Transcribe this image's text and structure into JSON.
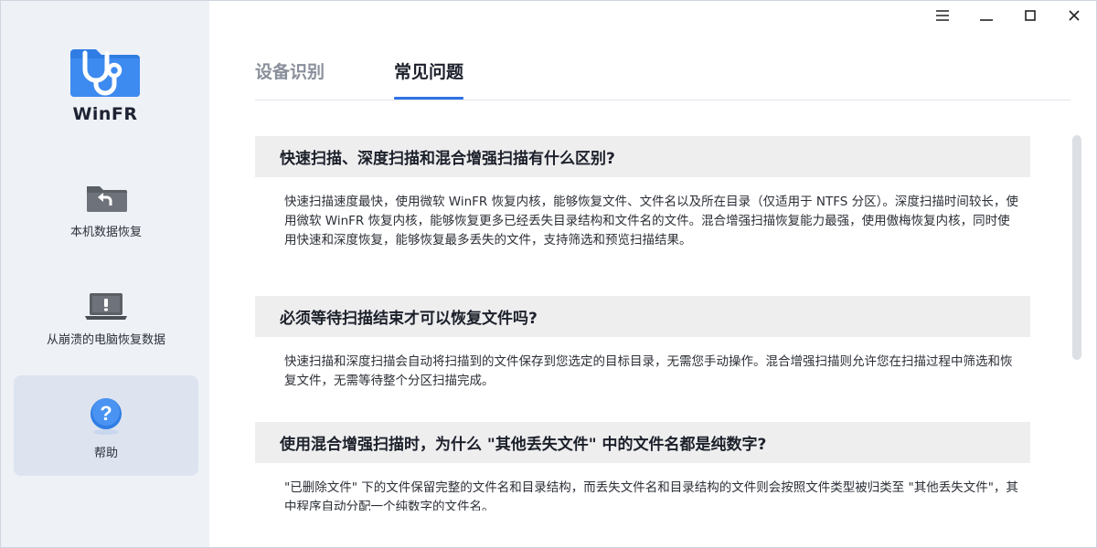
{
  "app": {
    "name": "WinFR"
  },
  "sidebar": {
    "items": [
      {
        "label": "本机数据恢复",
        "icon": "folder-restore-icon"
      },
      {
        "label": "从崩溃的电脑恢复数据",
        "icon": "laptop-warning-icon"
      },
      {
        "label": "帮助",
        "icon": "help-icon",
        "active": true
      }
    ]
  },
  "titlebar": {
    "buttons": [
      "menu-icon",
      "minimize-icon",
      "maximize-icon",
      "close-icon"
    ]
  },
  "tabs": [
    {
      "label": "设备识别",
      "active": false
    },
    {
      "label": "常见问题",
      "active": true
    }
  ],
  "faq": [
    {
      "question": "快速扫描、深度扫描和混合增强扫描有什么区别?",
      "answer": "快速扫描速度最快，使用微软 WinFR 恢复内核，能够恢复文件、文件名以及所在目录（仅适用于 NTFS 分区）。深度扫描时间较长，使用微软 WinFR 恢复内核，能够恢复更多已经丢失目录结构和文件名的文件。混合增强扫描恢复能力最强，使用傲梅恢复内核，同时使用快速和深度恢复，能够恢复最多丢失的文件，支持筛选和预览扫描结果。"
    },
    {
      "question": "必须等待扫描结束才可以恢复文件吗?",
      "answer": "快速扫描和深度扫描会自动将扫描到的文件保存到您选定的目标目录，无需您手动操作。混合增强扫描则允许您在扫描过程中筛选和恢复文件，无需等待整个分区扫描完成。"
    },
    {
      "question": "使用混合增强扫描时，为什么 \"其他丢失文件\" 中的文件名都是纯数字?",
      "answer": "\"已删除文件\" 下的文件保留完整的文件名和目录结构，而丢失文件名和目录结构的文件则会按照文件类型被归类至 \"其他丢失文件\"，其中程序自动分配一个纯数字的文件名。"
    }
  ],
  "colors": {
    "accent": "#2f72e6",
    "sidebar_bg": "#eef1f6",
    "active_item_bg": "#dde4f0",
    "question_bg": "#eeeeef"
  }
}
